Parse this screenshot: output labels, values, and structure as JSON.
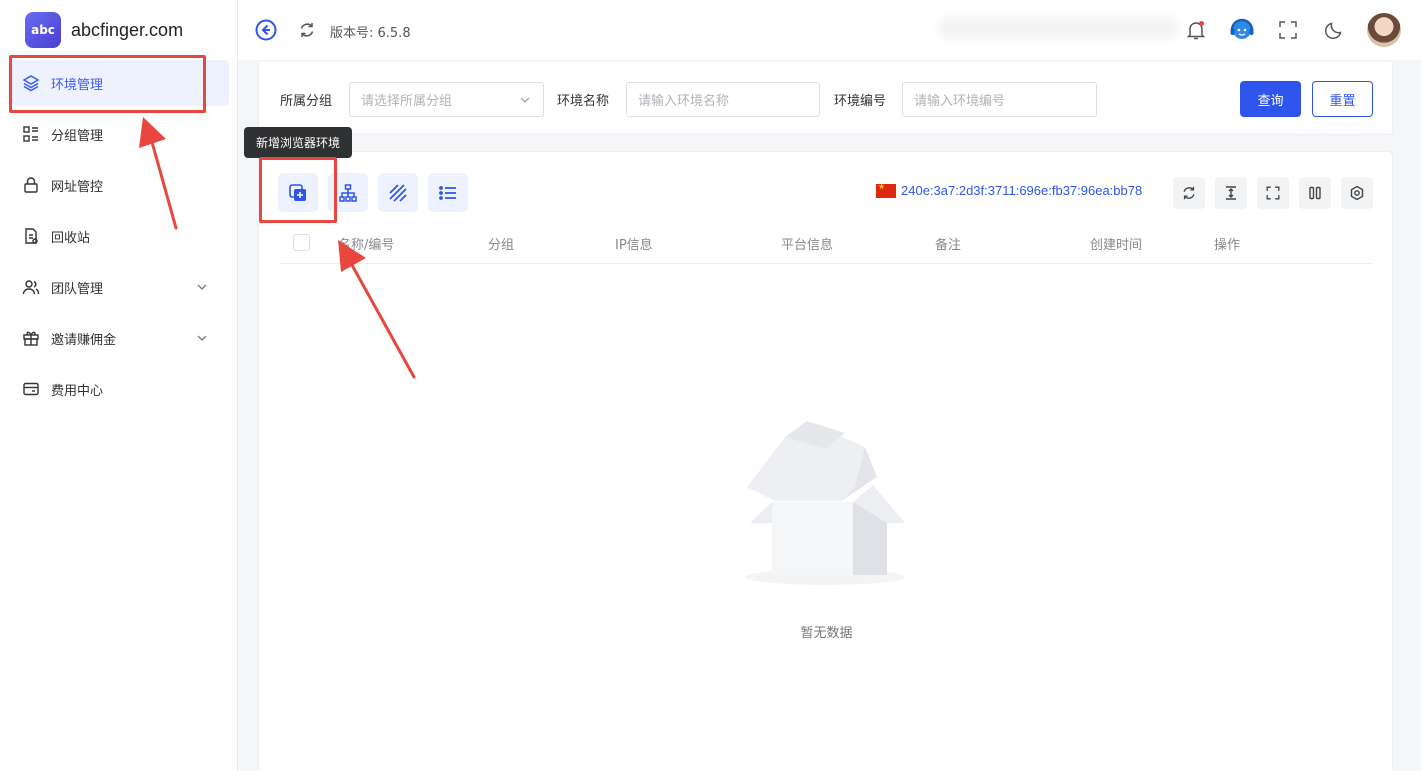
{
  "app": {
    "logo_abbr": "abc",
    "brand": "abcfinger.com"
  },
  "sidebar": {
    "items": [
      {
        "label": "环境管理",
        "icon": "layers-icon",
        "active": true
      },
      {
        "label": "分组管理",
        "icon": "group-list-icon"
      },
      {
        "label": "网址管控",
        "icon": "lock-icon"
      },
      {
        "label": "回收站",
        "icon": "recycle-doc-icon"
      },
      {
        "label": "团队管理",
        "icon": "team-icon",
        "expandable": true
      },
      {
        "label": "邀请赚佣金",
        "icon": "gift-icon",
        "expandable": true
      },
      {
        "label": "费用中心",
        "icon": "wallet-icon"
      }
    ]
  },
  "header": {
    "version": "版本号: 6.5.8",
    "icons": [
      "back-icon",
      "refresh-icon",
      "bell-icon",
      "customer-service-icon",
      "fullscreen-icon",
      "moon-icon",
      "avatar"
    ]
  },
  "filters": {
    "group_label": "所属分组",
    "group_placeholder": "请选择所属分组",
    "name_label": "环境名称",
    "name_placeholder": "请输入环境名称",
    "code_label": "环境编号",
    "code_placeholder": "请输入环境编号",
    "query_label": "查询",
    "reset_label": "重置"
  },
  "toolbar": {
    "tooltip": "新增浏览器环境",
    "ip": "240e:3a7:2d3f:3711:696e:fb37:96ea:bb78"
  },
  "table": {
    "columns": [
      "名称/编号",
      "分组",
      "IP信息",
      "平台信息",
      "备注",
      "创建时间",
      "操作"
    ],
    "empty_text": "暂无数据"
  },
  "colors": {
    "primary": "#2f54eb",
    "annotation": "#e8473f",
    "active_bg": "#eef2ff"
  }
}
